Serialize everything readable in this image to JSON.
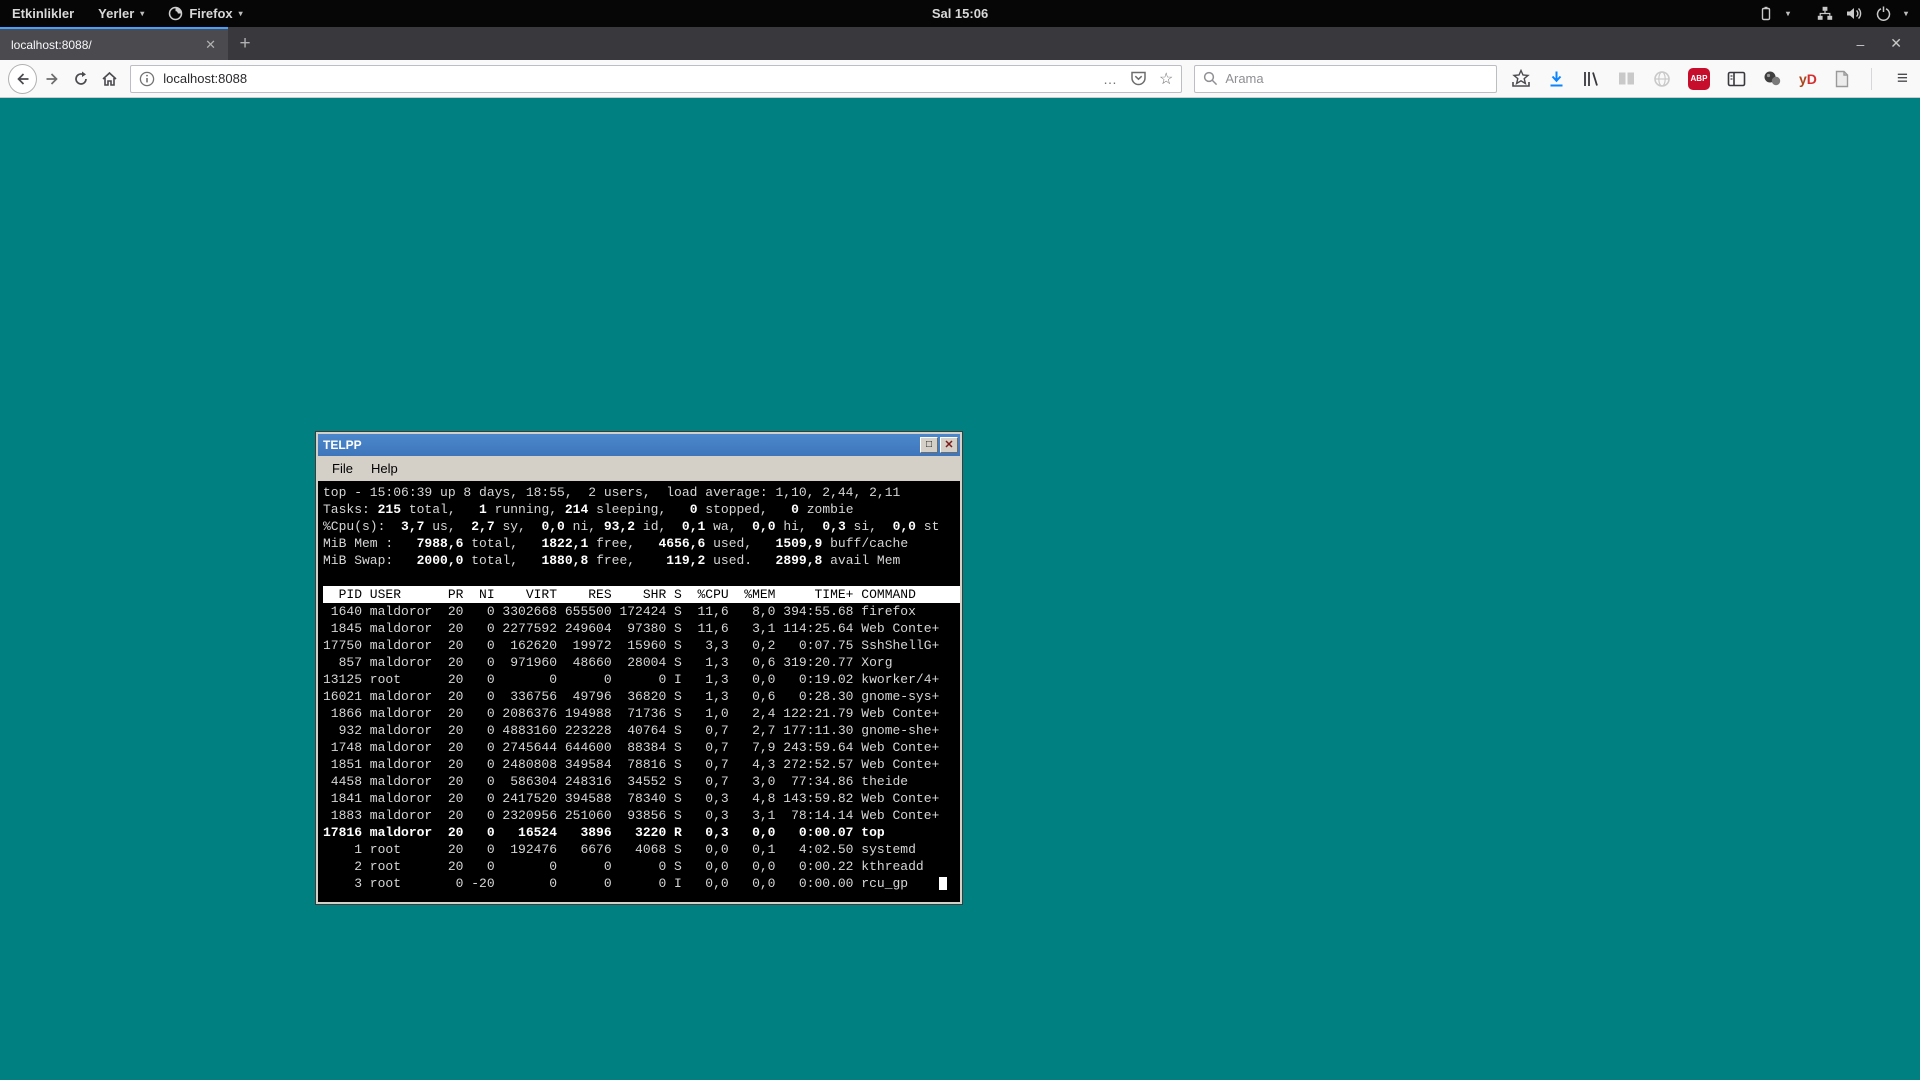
{
  "icons": {
    "close": "✕",
    "minimize": "–",
    "add": "+",
    "menu": "≡",
    "more": "…",
    "star": "☆",
    "caret": "▾",
    "maximize": "□"
  },
  "colors": {
    "desktop_teal": "#008080",
    "tab_accent": "#45a1ff",
    "titlebar_blue": "#4580c4",
    "download_blue": "#0a84ff",
    "abp_red": "#c70d2c",
    "terminal_bg": "#000000",
    "terminal_fg": "#d6d6d6",
    "header_bg": "#ffffff"
  },
  "topbar": {
    "activities": "Etkinlikler",
    "places": "Yerler",
    "app_menu": "Firefox",
    "clock": "Sal 15:06"
  },
  "browser": {
    "tab_title": "localhost:8088/",
    "url_value": "localhost:8088",
    "search_placeholder": "Arama",
    "abp_label": "ABP",
    "yd_label_y": "y",
    "yd_label_d": "D"
  },
  "app_window": {
    "title": "TELPP",
    "menu": [
      "File",
      "Help"
    ],
    "terminal": {
      "summary": [
        [
          {
            "t": "top - 15:06:39 up 8 days, 18:55,  2 users,  load average: 1,10, 2,44, 2,11",
            "b": 0
          }
        ],
        [
          {
            "t": "Tasks: ",
            "b": 0
          },
          {
            "t": "215",
            "b": 1
          },
          {
            "t": " total,   ",
            "b": 0
          },
          {
            "t": "1",
            "b": 1
          },
          {
            "t": " running, ",
            "b": 0
          },
          {
            "t": "214",
            "b": 1
          },
          {
            "t": " sleeping,   ",
            "b": 0
          },
          {
            "t": "0",
            "b": 1
          },
          {
            "t": " stopped,   ",
            "b": 0
          },
          {
            "t": "0",
            "b": 1
          },
          {
            "t": " zombie",
            "b": 0
          }
        ],
        [
          {
            "t": "%Cpu(s):  ",
            "b": 0
          },
          {
            "t": "3,7",
            "b": 1
          },
          {
            "t": " us,  ",
            "b": 0
          },
          {
            "t": "2,7",
            "b": 1
          },
          {
            "t": " sy,  ",
            "b": 0
          },
          {
            "t": "0,0",
            "b": 1
          },
          {
            "t": " ni, ",
            "b": 0
          },
          {
            "t": "93,2",
            "b": 1
          },
          {
            "t": " id,  ",
            "b": 0
          },
          {
            "t": "0,1",
            "b": 1
          },
          {
            "t": " wa,  ",
            "b": 0
          },
          {
            "t": "0,0",
            "b": 1
          },
          {
            "t": " hi,  ",
            "b": 0
          },
          {
            "t": "0,3",
            "b": 1
          },
          {
            "t": " si,  ",
            "b": 0
          },
          {
            "t": "0,0",
            "b": 1
          },
          {
            "t": " st",
            "b": 0
          }
        ],
        [
          {
            "t": "MiB Mem :   ",
            "b": 0
          },
          {
            "t": "7988,6",
            "b": 1
          },
          {
            "t": " total,   ",
            "b": 0
          },
          {
            "t": "1822,1",
            "b": 1
          },
          {
            "t": " free,   ",
            "b": 0
          },
          {
            "t": "4656,6",
            "b": 1
          },
          {
            "t": " used,   ",
            "b": 0
          },
          {
            "t": "1509,9",
            "b": 1
          },
          {
            "t": " buff/cache",
            "b": 0
          }
        ],
        [
          {
            "t": "MiB Swap:   ",
            "b": 0
          },
          {
            "t": "2000,0",
            "b": 1
          },
          {
            "t": " total,   ",
            "b": 0
          },
          {
            "t": "1880,8",
            "b": 1
          },
          {
            "t": " free,    ",
            "b": 0
          },
          {
            "t": "119,2",
            "b": 1
          },
          {
            "t": " used.   ",
            "b": 0
          },
          {
            "t": "2899,8",
            "b": 1
          },
          {
            "t": " avail Mem ",
            "b": 0
          }
        ]
      ],
      "header": "  PID USER      PR  NI    VIRT    RES    SHR S  %CPU  %MEM     TIME+ COMMAND ",
      "rows": [
        {
          "text": " 1640 maldoror  20   0 3302668 655500 172424 S  11,6   8,0 394:55.68 firefox",
          "b": 0,
          "c": 0
        },
        {
          "text": " 1845 maldoror  20   0 2277592 249604  97380 S  11,6   3,1 114:25.64 Web Conte+",
          "b": 0,
          "c": 0
        },
        {
          "text": "17750 maldoror  20   0  162620  19972  15960 S   3,3   0,2   0:07.75 SshShellG+",
          "b": 0,
          "c": 0
        },
        {
          "text": "  857 maldoror  20   0  971960  48660  28004 S   1,3   0,6 319:20.77 Xorg",
          "b": 0,
          "c": 0
        },
        {
          "text": "13125 root      20   0       0      0      0 I   1,3   0,0   0:19.02 kworker/4+",
          "b": 0,
          "c": 0
        },
        {
          "text": "16021 maldoror  20   0  336756  49796  36820 S   1,3   0,6   0:28.30 gnome-sys+",
          "b": 0,
          "c": 0
        },
        {
          "text": " 1866 maldoror  20   0 2086376 194988  71736 S   1,0   2,4 122:21.79 Web Conte+",
          "b": 0,
          "c": 0
        },
        {
          "text": "  932 maldoror  20   0 4883160 223228  40764 S   0,7   2,7 177:11.30 gnome-she+",
          "b": 0,
          "c": 0
        },
        {
          "text": " 1748 maldoror  20   0 2745644 644600  88384 S   0,7   7,9 243:59.64 Web Conte+",
          "b": 0,
          "c": 0
        },
        {
          "text": " 1851 maldoror  20   0 2480808 349584  78816 S   0,7   4,3 272:52.57 Web Conte+",
          "b": 0,
          "c": 0
        },
        {
          "text": " 4458 maldoror  20   0  586304 248316  34552 S   0,7   3,0  77:34.86 theide",
          "b": 0,
          "c": 0
        },
        {
          "text": " 1841 maldoror  20   0 2417520 394588  78340 S   0,3   4,8 143:59.82 Web Conte+",
          "b": 0,
          "c": 0
        },
        {
          "text": " 1883 maldoror  20   0 2320956 251060  93856 S   0,3   3,1  78:14.14 Web Conte+",
          "b": 0,
          "c": 0
        },
        {
          "text": "17816 maldoror  20   0   16524   3896   3220 R   0,3   0,0   0:00.07 top",
          "b": 1,
          "c": 0
        },
        {
          "text": "    1 root      20   0  192476   6676   4068 S   0,0   0,1   4:02.50 systemd",
          "b": 0,
          "c": 0
        },
        {
          "text": "    2 root      20   0       0      0      0 S   0,0   0,0   0:00.22 kthreadd",
          "b": 0,
          "c": 0
        },
        {
          "text": "    3 root       0 -20       0      0      0 I   0,0   0,0   0:00.00 rcu_gp",
          "b": 0,
          "c": 1
        }
      ]
    }
  }
}
